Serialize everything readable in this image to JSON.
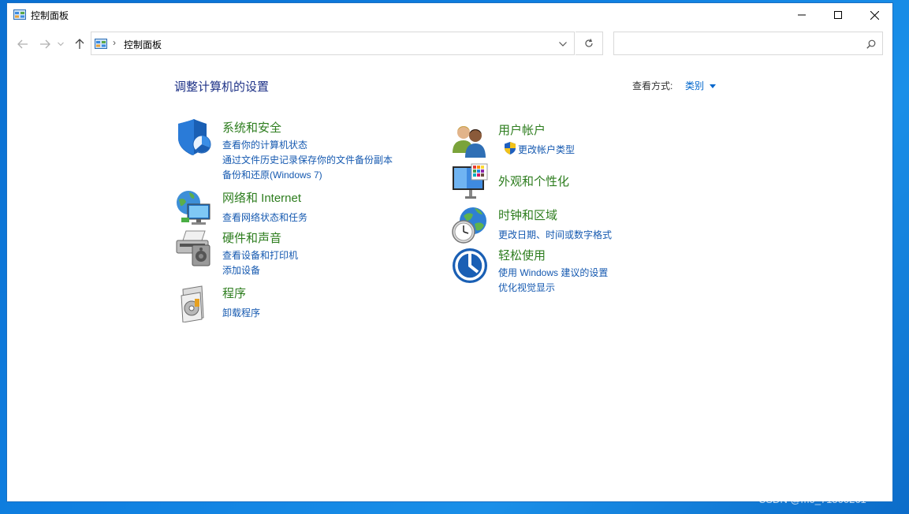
{
  "window": {
    "title": "控制面板",
    "buttons": {
      "minimize": "─",
      "maximize": "☐",
      "close": "✕"
    }
  },
  "toolbar": {
    "breadcrumb_separator": "›",
    "breadcrumb_item": "控制面板",
    "search_placeholder": ""
  },
  "main": {
    "heading": "调整计算机的设置",
    "view_by_label": "查看方式:",
    "view_by_value": "类别"
  },
  "categories": {
    "security": {
      "title": "系统和安全",
      "links": [
        "查看你的计算机状态",
        "通过文件历史记录保存你的文件备份副本",
        "备份和还原(Windows 7)"
      ]
    },
    "network": {
      "title": "网络和 Internet",
      "links": [
        "查看网络状态和任务"
      ]
    },
    "hardware": {
      "title": "硬件和声音",
      "links": [
        "查看设备和打印机",
        "添加设备"
      ]
    },
    "programs": {
      "title": "程序",
      "links": [
        "卸载程序"
      ]
    },
    "users": {
      "title": "用户帐户",
      "links": [
        "更改帐户类型"
      ]
    },
    "appearance": {
      "title": "外观和个性化",
      "links": []
    },
    "clock": {
      "title": "时钟和区域",
      "links": [
        "更改日期、时间或数字格式"
      ]
    },
    "ease": {
      "title": "轻松使用",
      "links": [
        "使用 Windows 建议的设置",
        "优化视觉显示"
      ]
    }
  },
  "watermark": "CSDN @m0_71500261",
  "colors": {
    "title_green": "#2d7d1e",
    "link_blue": "#1559b0",
    "heading_blue": "#1e3287",
    "desktop_blue": "#0f7fe0"
  }
}
